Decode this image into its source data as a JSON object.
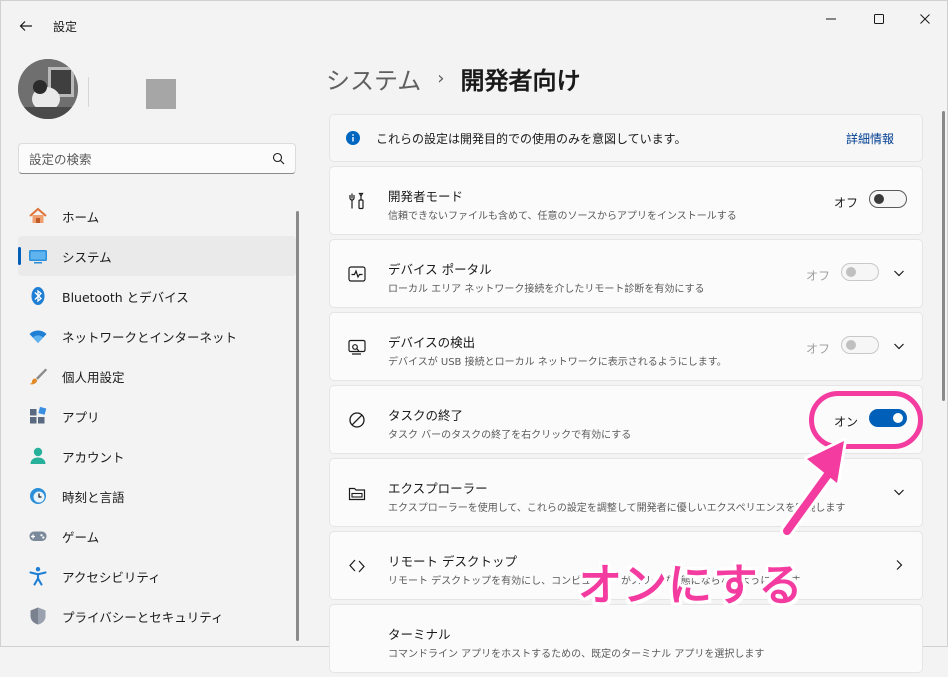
{
  "window": {
    "title": "設定"
  },
  "sidebar": {
    "search_placeholder": "設定の検索",
    "items": [
      {
        "label": "ホーム",
        "icon": "home-icon"
      },
      {
        "label": "システム",
        "icon": "system-icon",
        "active": true
      },
      {
        "label": "Bluetooth とデバイス",
        "icon": "bluetooth-icon"
      },
      {
        "label": "ネットワークとインターネット",
        "icon": "wifi-icon"
      },
      {
        "label": "個人用設定",
        "icon": "brush-icon"
      },
      {
        "label": "アプリ",
        "icon": "apps-icon"
      },
      {
        "label": "アカウント",
        "icon": "account-icon"
      },
      {
        "label": "時刻と言語",
        "icon": "clock-globe-icon"
      },
      {
        "label": "ゲーム",
        "icon": "gamepad-icon"
      },
      {
        "label": "アクセシビリティ",
        "icon": "accessibility-icon"
      },
      {
        "label": "プライバシーとセキュリティ",
        "icon": "shield-icon"
      }
    ]
  },
  "breadcrumb": {
    "parent": "システム",
    "separator": "›",
    "current": "開発者向け"
  },
  "info": {
    "text": "これらの設定は開発目的での使用のみを意図しています。",
    "link": "詳細情報"
  },
  "rows": [
    {
      "title": "開発者モード",
      "desc": "信頼できないファイルも含めて、任意のソースからアプリをインストールする",
      "state": "オフ"
    },
    {
      "title": "デバイス ポータル",
      "desc": "ローカル エリア ネットワーク接続を介したリモート診断を有効にする",
      "state": "オフ"
    },
    {
      "title": "デバイスの検出",
      "desc": "デバイスが USB 接続とローカル ネットワークに表示されるようにします。",
      "state": "オフ"
    },
    {
      "title": "タスクの終了",
      "desc": "タスク バーのタスクの終了を右クリックで有効にする",
      "state": "オン"
    },
    {
      "title": "エクスプローラー",
      "desc": "エクスプローラーを使用して、これらの設定を調整して開発者に優しいエクスペリエンスを実現します"
    },
    {
      "title": "リモート デスクトップ",
      "desc": "リモート デスクトップを有効にし、コンピューターがスリープ状態にならないようにします"
    },
    {
      "title": "ターミナル",
      "desc": "コマンドライン アプリをホストするための、既定のターミナル アプリを選択します"
    }
  ],
  "annotation": {
    "text": "オンにする"
  },
  "colors": {
    "accent": "#005fb8",
    "annotation": "#f33ba0",
    "info": "#0067c0"
  }
}
